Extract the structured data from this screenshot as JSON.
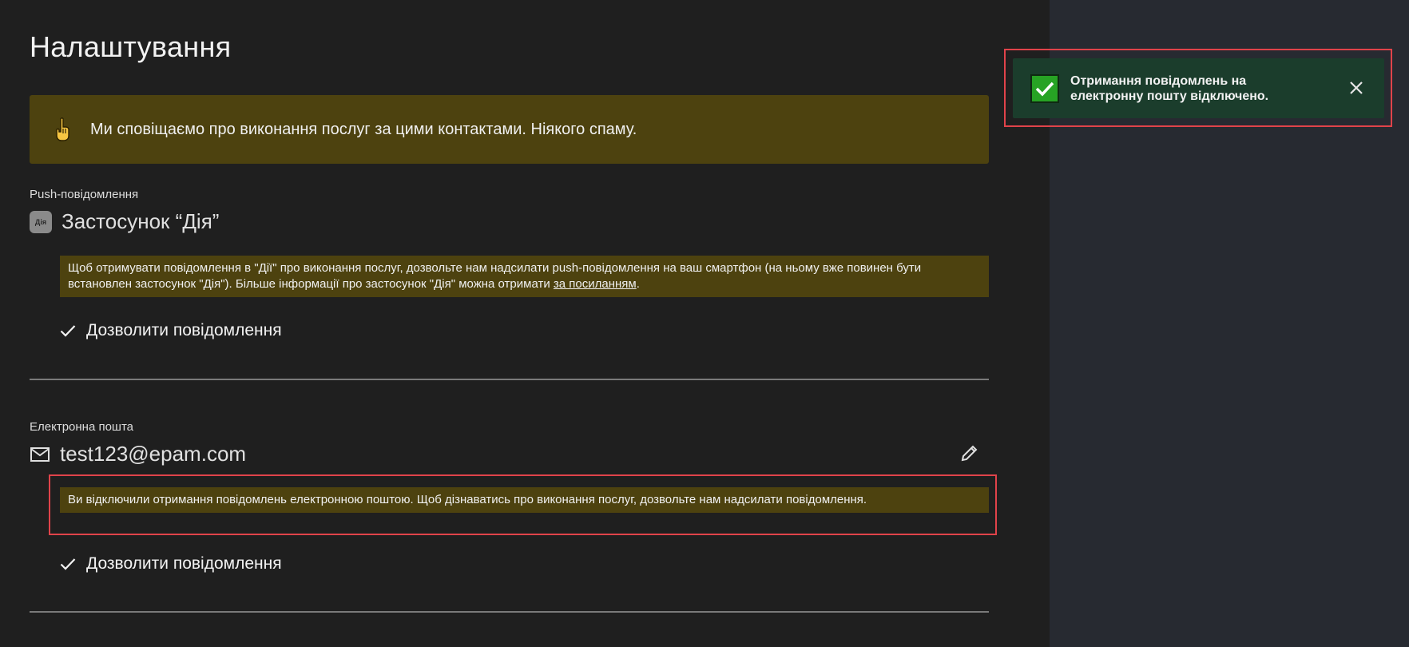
{
  "page": {
    "title": "Налаштування"
  },
  "banner": {
    "text": "Ми сповіщаємо про виконання послуг за цими контактами. Ніякого спаму.",
    "icon": "pointing-hand-icon"
  },
  "push": {
    "label": "Push-повідомлення",
    "app_badge": "Дія",
    "title": "Застосунок “Дія”",
    "note": "Щоб отримувати повідомлення в \"Дії\" про виконання послуг, дозвольте нам надсилати push-повідомлення на ваш смартфон (на ньому вже повинен бути встановлен застосунок \"Дія\"). Більше інформації про застосунок \"Дія\" можна отримати ",
    "note_link": "за посиланням",
    "note_end": ".",
    "allow_label": "Дозволити повідомлення"
  },
  "email": {
    "label": "Електронна пошта",
    "address": "test123@epam.com",
    "note": "Ви відключили отримання повідомлень електронною поштою. Щоб дізнаватись про виконання послуг, дозвольте нам надсилати повідомлення.",
    "allow_label": "Дозволити повідомлення"
  },
  "toast": {
    "message": "Отримання повідомлень на електронну пошту відключено.",
    "status": "success"
  },
  "colors": {
    "background": "#1f1f1f",
    "sidebar": "#272a31",
    "banner": "#4d420f",
    "toast": "#1b3d2c",
    "success": "#27a324",
    "highlight": "#e0434a"
  }
}
